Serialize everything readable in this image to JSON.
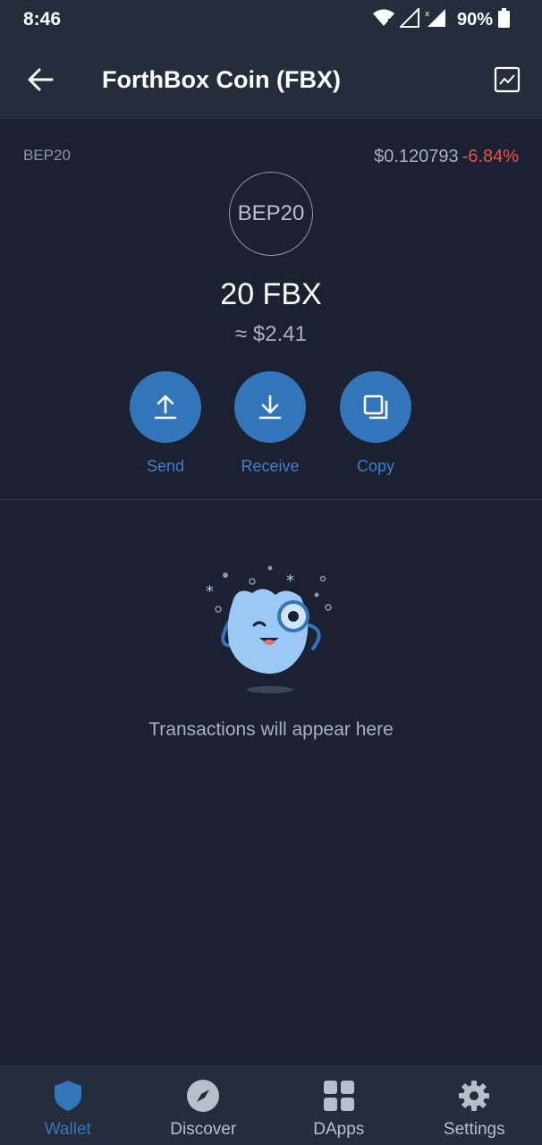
{
  "status_bar": {
    "time": "8:46",
    "battery": "90%"
  },
  "header": {
    "title": "ForthBox Coin (FBX)"
  },
  "token": {
    "network": "BEP20",
    "logo_text": "BEP20",
    "price": "$0.120793",
    "change": "-6.84%",
    "balance": "20 FBX",
    "fiat_value": "≈ $2.41"
  },
  "actions": [
    {
      "label": "Send"
    },
    {
      "label": "Receive"
    },
    {
      "label": "Copy"
    }
  ],
  "empty_state": {
    "message": "Transactions will appear here"
  },
  "bottom_nav": [
    {
      "label": "Wallet",
      "icon": "shield-icon",
      "active": true
    },
    {
      "label": "Discover",
      "icon": "compass-icon",
      "active": false
    },
    {
      "label": "DApps",
      "icon": "grid-icon",
      "active": false
    },
    {
      "label": "Settings",
      "icon": "gear-icon",
      "active": false
    }
  ],
  "colors": {
    "background": "#1b2130",
    "bar": "#252d3c",
    "accent": "#3375bb",
    "negative": "#e5534b",
    "muted_text": "#a8b1c0"
  }
}
